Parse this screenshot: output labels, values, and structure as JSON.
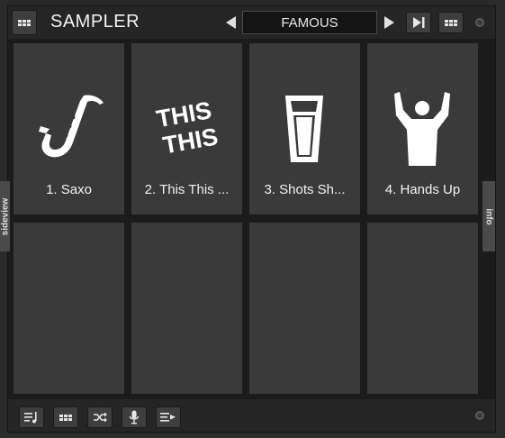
{
  "header": {
    "title": "SAMPLER",
    "bank_name": "FAMOUS"
  },
  "pads": [
    {
      "label": "1. Saxo",
      "icon": "saxophone-icon"
    },
    {
      "label": "2. This This ...",
      "icon": "this-this-text-icon",
      "art_text": [
        "THIS",
        "THIS"
      ]
    },
    {
      "label": "3. Shots Sh...",
      "icon": "shot-glass-icon"
    },
    {
      "label": "4. Hands Up",
      "icon": "hands-up-person-icon"
    },
    {
      "label": "",
      "icon": ""
    },
    {
      "label": "",
      "icon": ""
    },
    {
      "label": "",
      "icon": ""
    },
    {
      "label": "",
      "icon": ""
    }
  ],
  "side_tabs": {
    "left": "sideview",
    "right": "info"
  },
  "footer": {
    "buttons": [
      "playlist-icon",
      "grid-icon",
      "shuffle-icon",
      "microphone-icon",
      "list-arrow-icon"
    ]
  },
  "colors": {
    "pad_bg": "#3a3a3a",
    "panel_bg": "#1b1b1b",
    "text": "#f2f2f2"
  }
}
